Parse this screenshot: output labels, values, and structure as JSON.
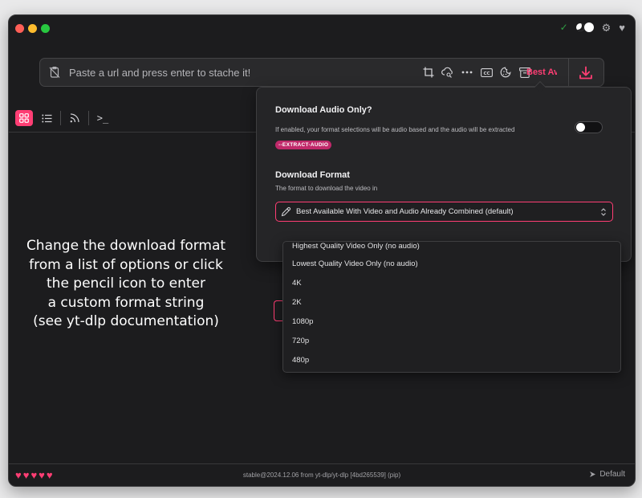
{
  "url_bar": {
    "placeholder": "Paste a url and press enter to stache it!",
    "format_label": "Best Av"
  },
  "caption_lines": [
    "Change the download format",
    "from a list of options or click",
    "the pencil icon to enter",
    "a custom format string",
    "(see yt-dlp documentation)"
  ],
  "panel": {
    "audio_title": "Download Audio Only?",
    "audio_desc": "If enabled, your format selections will be audio based and the audio will be extracted",
    "audio_badge": "--EXTRACT-AUDIO",
    "format_title": "Download Format",
    "format_desc": "The format to download the video in",
    "selected_format": "Best Available With Video and Audio Already Combined (default)"
  },
  "format_options": [
    "Highest Quality Video Only (no audio)",
    "Lowest Quality Video Only (no audio)",
    "4K",
    "2K",
    "1080p",
    "720p",
    "480p"
  ],
  "status": {
    "version": "stable@2024.12.06 from yt-dlp/yt-dlp [4bd265539] (pip)",
    "theme": "Default"
  },
  "icons": {
    "title_bar": [
      "check-icon",
      "theme-toggle",
      "gear-icon",
      "heart-icon"
    ],
    "url_tools": [
      "crop-icon",
      "cloud-search-icon",
      "more-icon",
      "cc-icon",
      "cookie-icon",
      "archive-icon"
    ],
    "view_modes": [
      "grid-icon",
      "list-icon",
      "rss-icon",
      "terminal-icon"
    ]
  },
  "colors": {
    "accent": "#ff3e74",
    "window_bg": "#1c1c1e",
    "panel_bg": "#252527"
  }
}
